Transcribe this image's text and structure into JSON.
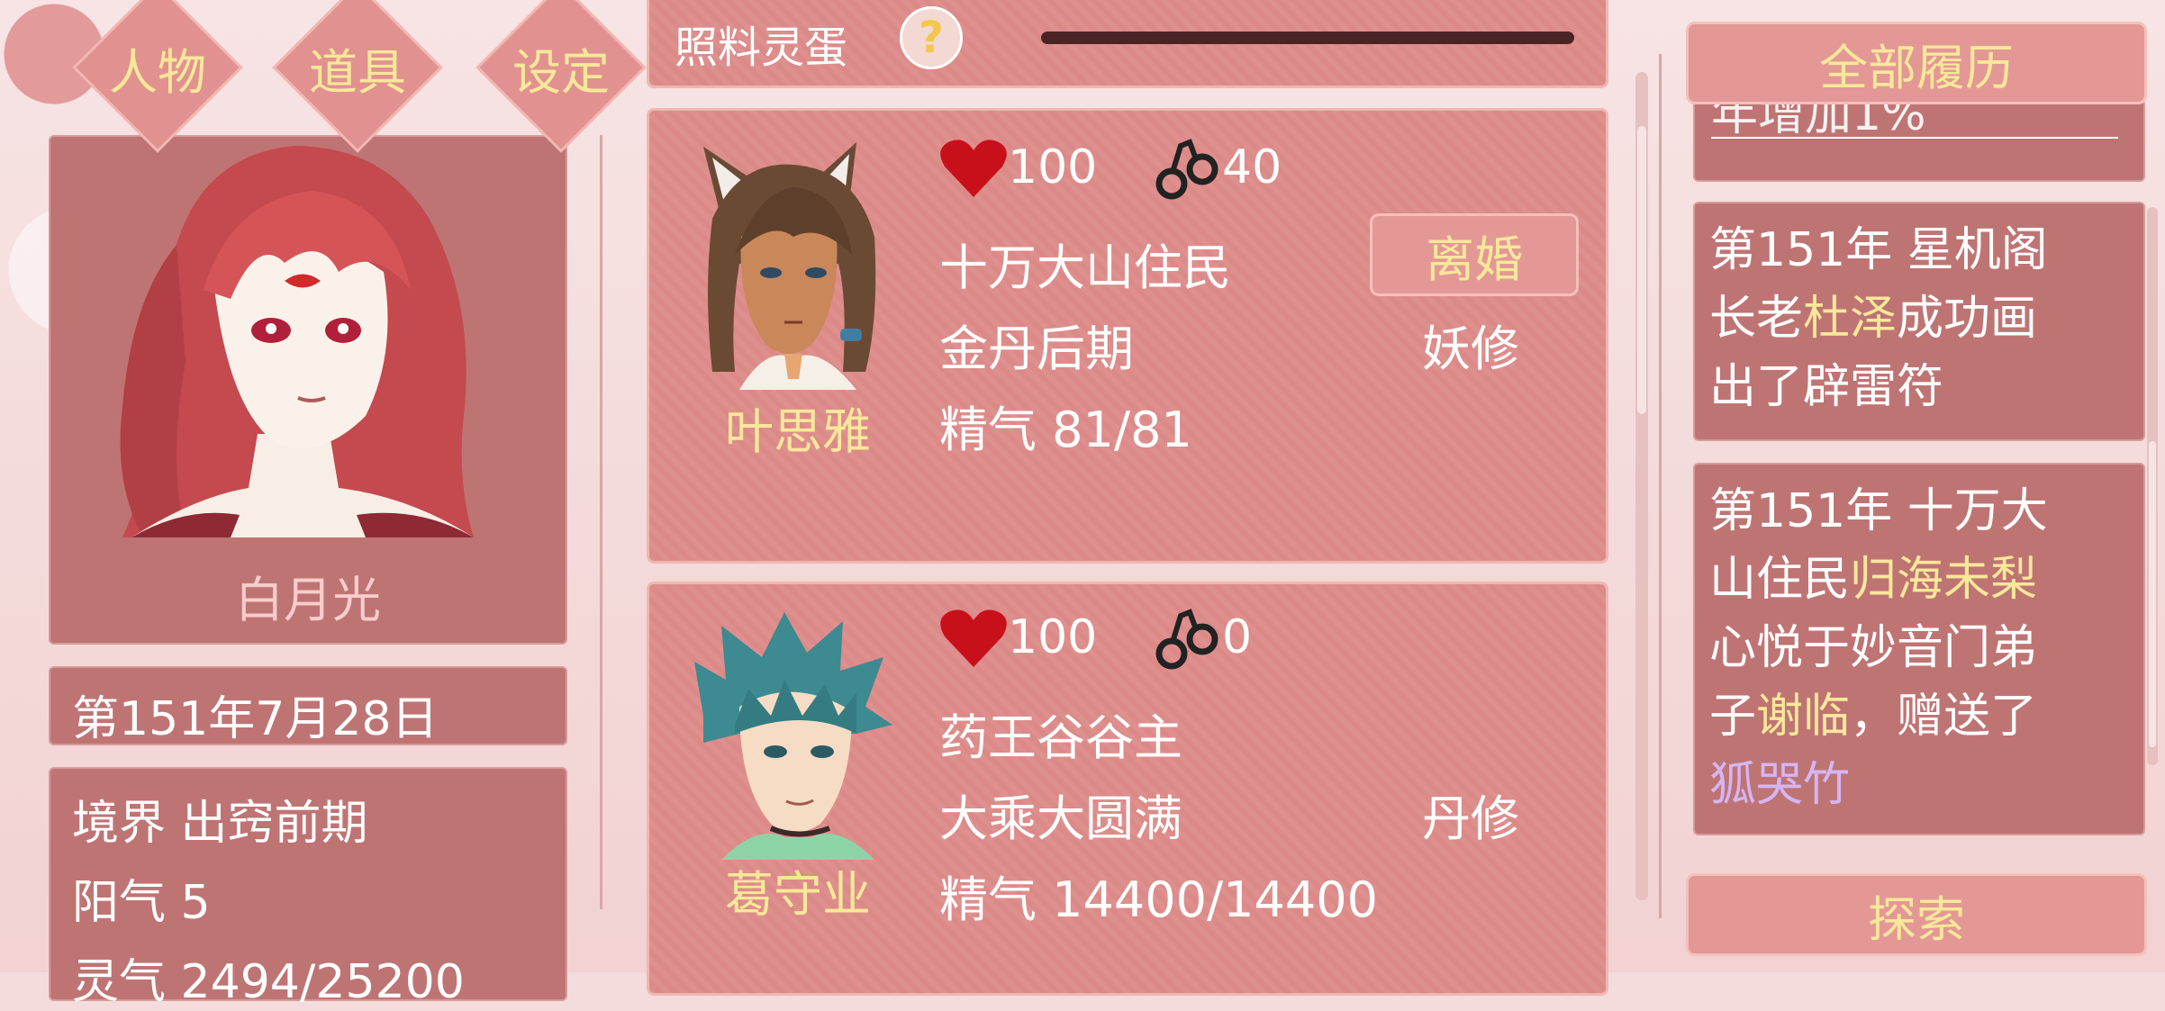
{
  "tabs": [
    {
      "label": "人物"
    },
    {
      "label": "道具"
    },
    {
      "label": "设定"
    }
  ],
  "player": {
    "name": "白月光",
    "date": "第151年7月28日",
    "stats": [
      {
        "label": "境界",
        "value": "出窍前期"
      },
      {
        "label": "阳气",
        "value": "5"
      },
      {
        "label": "灵气",
        "value": "2494/25200"
      }
    ]
  },
  "top_bar": {
    "title": "照料灵蛋",
    "help_icon": "question-icon"
  },
  "partners": [
    {
      "name": "叶思雅",
      "affection": "100",
      "bond": "40",
      "faction": "十万大山住民",
      "realm": "金丹后期",
      "cultivation_type": "妖修",
      "essence_label": "精气",
      "essence": "81/81",
      "action": "离婚"
    },
    {
      "name": "葛守业",
      "affection": "100",
      "bond": "0",
      "faction": "药王谷谷主",
      "realm": "大乘大圆满",
      "cultivation_type": "丹修",
      "essence_label": "精气",
      "essence": "14400/14400"
    }
  ],
  "history": {
    "title_button": "全部履历",
    "clipped_entry": "年增加1%",
    "entries": [
      {
        "lines": [
          [
            {
              "t": "第151年 星机阁"
            }
          ],
          [
            {
              "t": "长老"
            },
            {
              "t": "杜泽",
              "c": "gold"
            },
            {
              "t": "成功画"
            }
          ],
          [
            {
              "t": "出了辟雷符"
            }
          ]
        ]
      },
      {
        "lines": [
          [
            {
              "t": "第151年 十万大"
            }
          ],
          [
            {
              "t": "山住民"
            },
            {
              "t": "归海未梨",
              "c": "gold"
            }
          ],
          [
            {
              "t": "心悦于妙音门弟"
            }
          ],
          [
            {
              "t": "子"
            },
            {
              "t": "谢临",
              "c": "gold"
            },
            {
              "t": "，赠送了"
            }
          ],
          [
            {
              "t": "狐哭竹",
              "c": "lilac"
            }
          ]
        ]
      }
    ],
    "explore_button": "探索"
  },
  "icons": {
    "heart": "heart-icon",
    "bond": "handcuffs-icon"
  },
  "colors": {
    "panel": "#bf7474",
    "card": "#dc8a88",
    "gold_text": "#f8e89a",
    "lilac_text": "#d4b6f2",
    "heart": "#c8101a"
  }
}
